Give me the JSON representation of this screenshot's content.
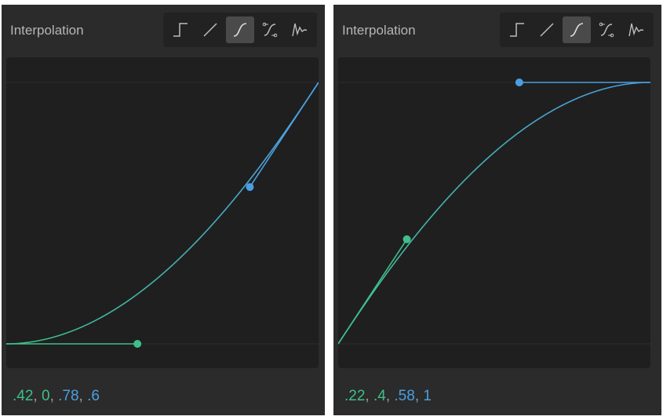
{
  "colors": {
    "accent_green": "#3fbf8a",
    "accent_blue": "#4a9fe3",
    "panel_bg": "#2b2b2b",
    "graph_bg": "#1f1f1f"
  },
  "toolbar_icons": [
    "step-icon",
    "linear-icon",
    "ease-curve-icon",
    "bezier-handles-icon",
    "spring-icon"
  ],
  "panels": [
    {
      "title": "Interpolation",
      "active_tool": "ease-curve-icon",
      "bezier": [
        0.42,
        0,
        0.78,
        0.6
      ],
      "values": {
        "v1": ".42",
        "v2": "0",
        "v3": ".78",
        "v4": ".6",
        "sep": ", "
      }
    },
    {
      "title": "Interpolation",
      "active_tool": "ease-curve-icon",
      "bezier": [
        0.22,
        0.4,
        0.58,
        1
      ],
      "values": {
        "v1": ".22",
        "v2": ".4",
        "v3": ".58",
        "v4": "1",
        "sep": ", "
      }
    }
  ]
}
